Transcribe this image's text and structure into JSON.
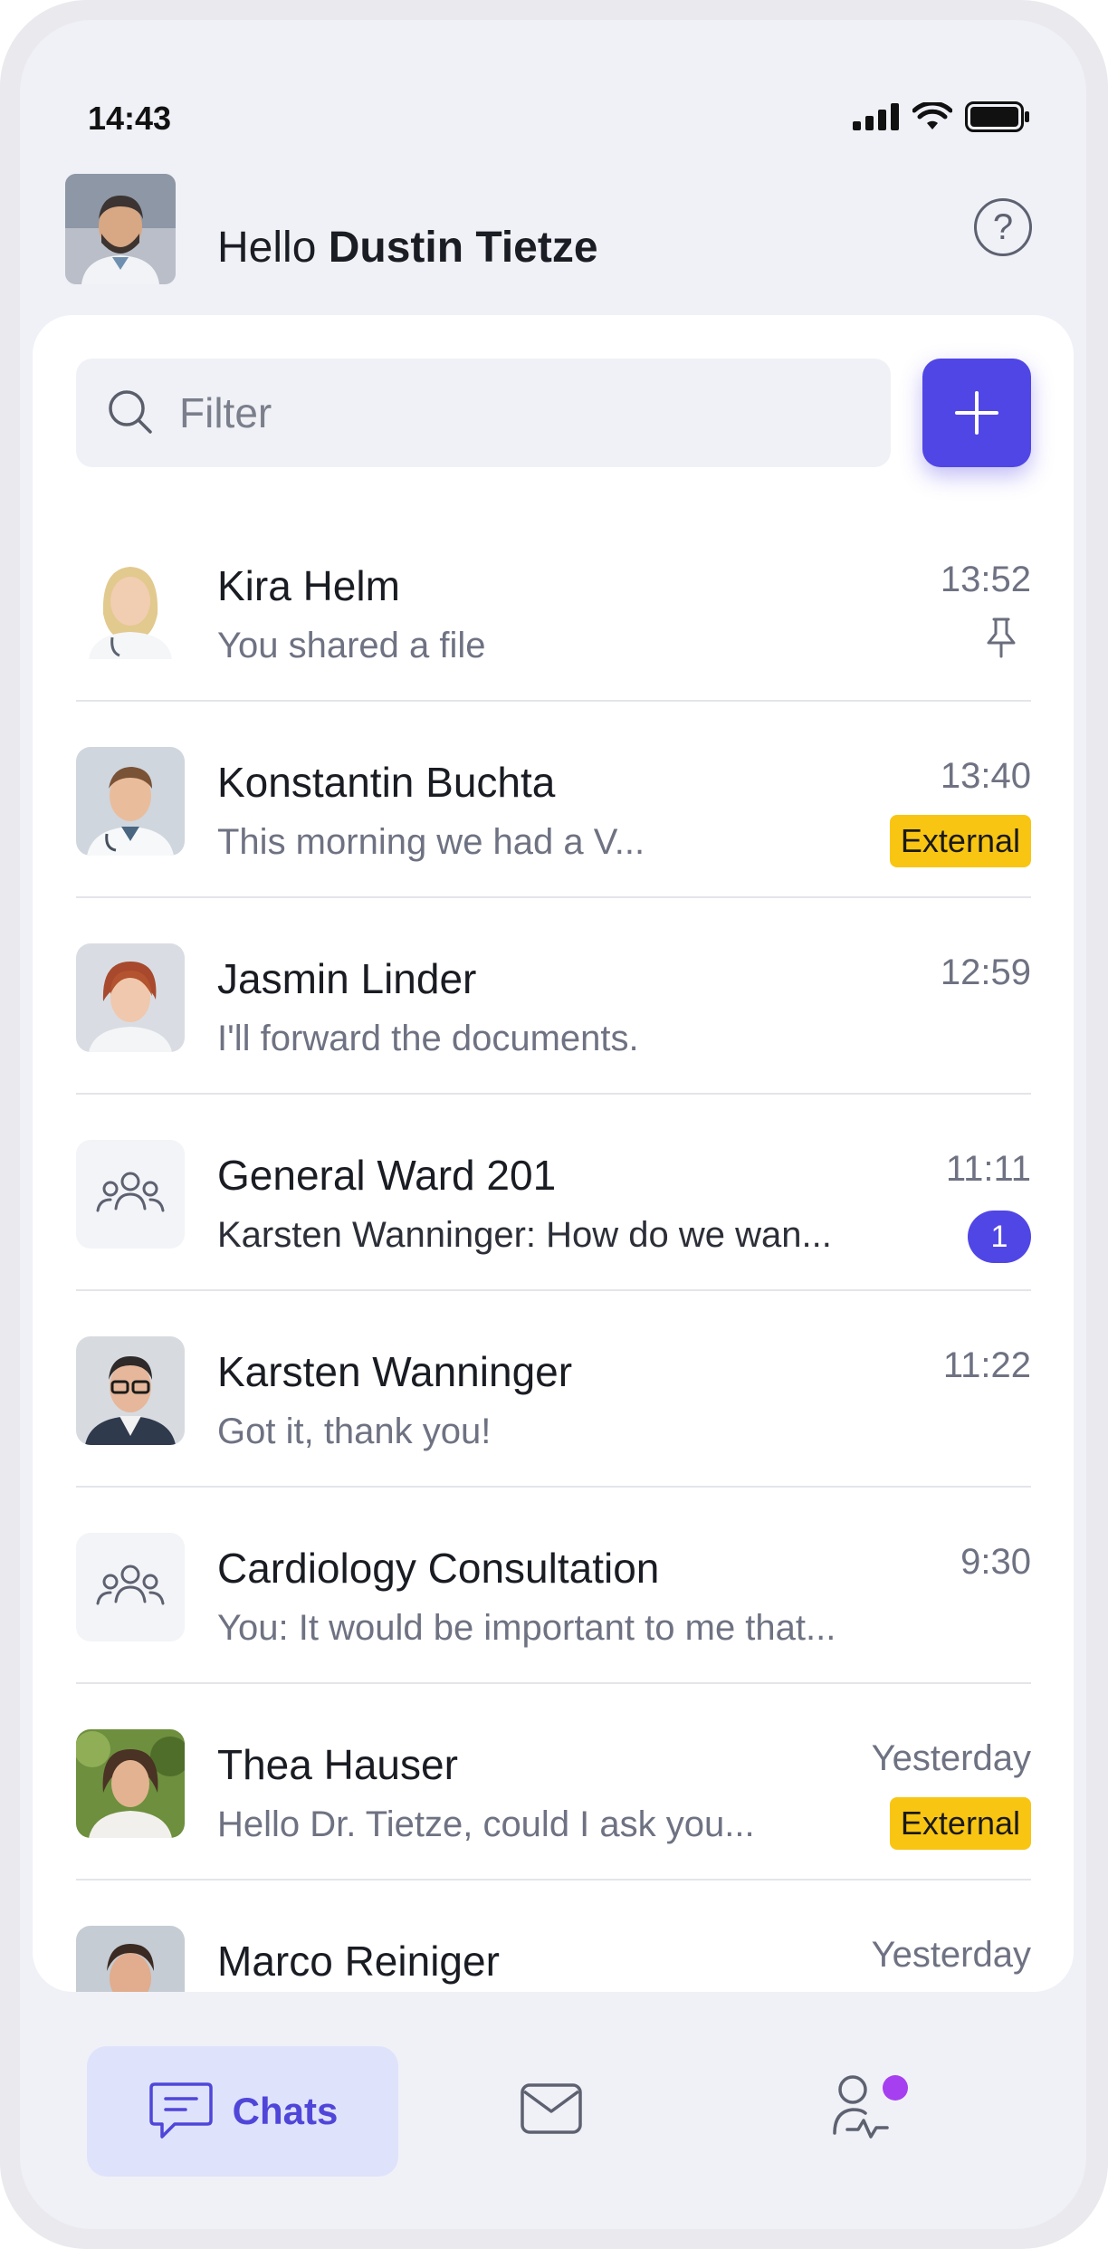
{
  "status_bar": {
    "time": "14:43"
  },
  "header": {
    "greeting_prefix": "Hello ",
    "user_name": "Dustin Tietze",
    "help_label": "?"
  },
  "search": {
    "placeholder": "Filter"
  },
  "chats": [
    {
      "name": "Kira Helm",
      "preview": "You shared a file",
      "time": "13:52",
      "pinned": true,
      "avatar": "photo"
    },
    {
      "name": "Konstantin Buchta",
      "preview": "This morning we had a V...",
      "time": "13:40",
      "badge": "External",
      "avatar": "photo"
    },
    {
      "name": "Jasmin Linder",
      "preview": "I'll forward the documents.",
      "time": "12:59",
      "avatar": "photo"
    },
    {
      "name": "General Ward 201",
      "preview": "Karsten Wanninger: How do we wan...",
      "time": "11:11",
      "unread": "1",
      "avatar": "group"
    },
    {
      "name": "Karsten Wanninger",
      "preview": "Got it, thank you!",
      "time": "11:22",
      "avatar": "photo"
    },
    {
      "name": "Cardiology Consultation",
      "preview": "You: It would be important to me that...",
      "time": "9:30",
      "avatar": "group"
    },
    {
      "name": "Thea Hauser",
      "preview": "Hello Dr. Tietze, could I ask you...",
      "time": "Yesterday",
      "badge": "External",
      "avatar": "photo"
    },
    {
      "name": "Marco Reiniger",
      "preview": "",
      "time": "Yesterday",
      "avatar": "photo"
    }
  ],
  "bottom_nav": {
    "chats_label": "Chats",
    "items": [
      "chat-bubble-icon",
      "mail-icon",
      "profile-pulse-icon"
    ]
  },
  "colors": {
    "accent": "#5046e5",
    "external_badge": "#f9c513",
    "notification_dot": "#a63ff0"
  }
}
